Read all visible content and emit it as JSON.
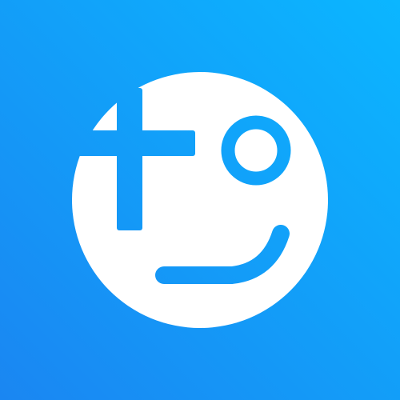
{
  "icon": {
    "name": "smiley-face-logo",
    "depicts": [
      "plus-sign",
      "circle-eye",
      "smile-curve"
    ]
  },
  "colors": {
    "background_gradient_start": "#1A86F2",
    "background_gradient_end": "#0BB6FF",
    "face": "#FFFFFF"
  }
}
